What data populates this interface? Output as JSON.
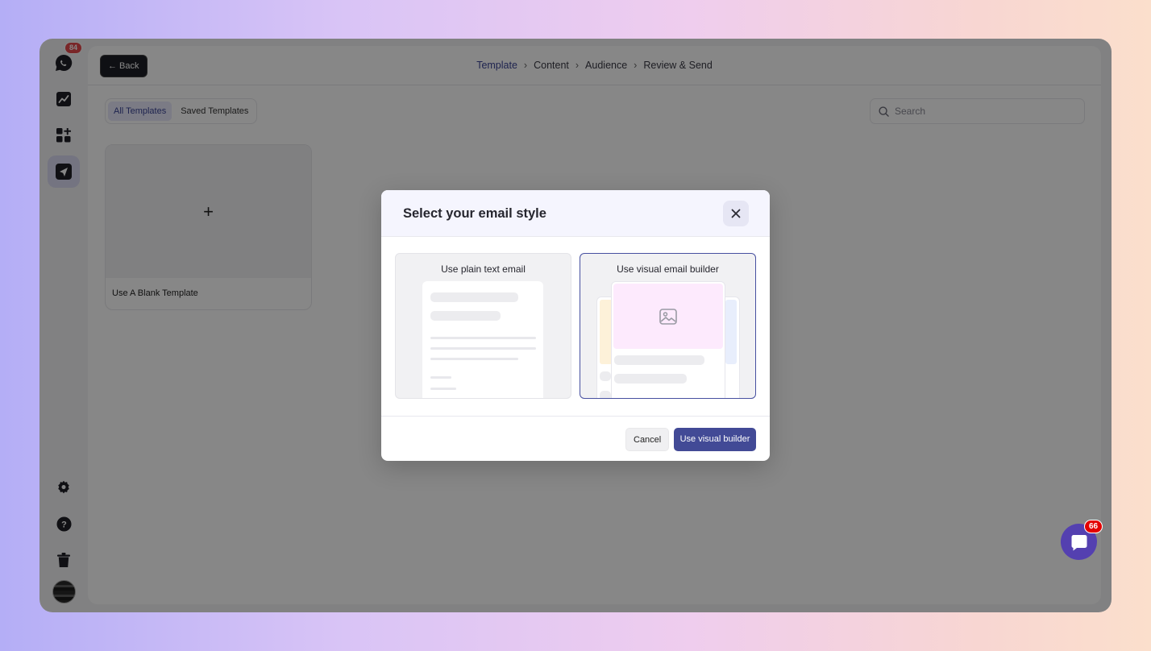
{
  "sidebar": {
    "notification_count": "84",
    "items": [
      {
        "icon": "chat-logo-icon"
      },
      {
        "icon": "analytics-icon"
      },
      {
        "icon": "add-widget-icon"
      },
      {
        "icon": "send-icon",
        "active": true
      },
      {
        "icon": "gear-icon"
      },
      {
        "icon": "help-icon"
      },
      {
        "icon": "trash-icon"
      }
    ]
  },
  "header": {
    "back_label": "← Back",
    "breadcrumbs": [
      "Template",
      "Content",
      "Audience",
      "Review & Send"
    ]
  },
  "tabs": [
    "All Templates",
    "Saved Templates"
  ],
  "search": {
    "placeholder": "Search"
  },
  "blank_template": {
    "plus": "+",
    "label": "Use A Blank Template"
  },
  "modal": {
    "title": "Select your email style",
    "option_plain": "Use plain text email",
    "option_visual": "Use visual email builder",
    "cancel_label": "Cancel",
    "confirm_label": "Use visual builder"
  },
  "chat": {
    "unread_count": "66"
  },
  "colors": {
    "accent": "#424a96",
    "badge": "#e5484d"
  }
}
